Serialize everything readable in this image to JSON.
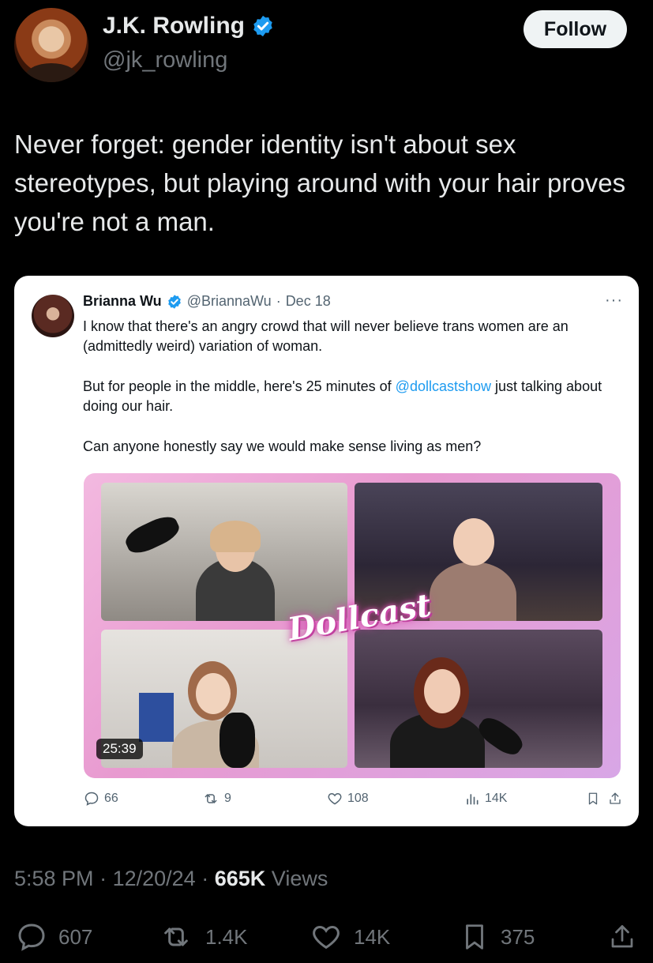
{
  "author": {
    "display_name": "J.K. Rowling",
    "handle": "@jk_rowling",
    "verified": true,
    "follow_label": "Follow"
  },
  "tweet": {
    "text": "Never forget: gender identity isn't about sex stereotypes, but playing around with your hair proves you're not a man."
  },
  "quoted": {
    "display_name": "Brianna Wu",
    "handle": "@BriannaWu",
    "separator": "·",
    "date": "Dec 18",
    "verified": true,
    "more_label": "···",
    "paragraph_1": "I know that there's an angry crowd that will never believe trans women are an (admittedly weird) variation of woman.",
    "paragraph_2_before": "But for people in the middle, here's 25 minutes of ",
    "paragraph_2_mention": "@dollcastshow",
    "paragraph_2_after": " just talking about doing our hair.",
    "paragraph_3": "Can anyone honestly say we would make sense living as men?",
    "media": {
      "logo_text": "Dollcast",
      "duration": "25:39"
    },
    "stats": {
      "replies": "66",
      "reposts": "9",
      "likes": "108",
      "views": "14K"
    }
  },
  "meta": {
    "time": "5:58 PM",
    "date": "12/20/24",
    "sep": "·",
    "views_count": "665K",
    "views_label": "Views"
  },
  "stats": {
    "replies": "607",
    "reposts": "1.4K",
    "likes": "14K",
    "bookmarks": "375"
  },
  "colors": {
    "background": "#000000",
    "verified": "#1d9bf0",
    "mention": "#1d9bf0",
    "secondary_text": "#71767b"
  }
}
